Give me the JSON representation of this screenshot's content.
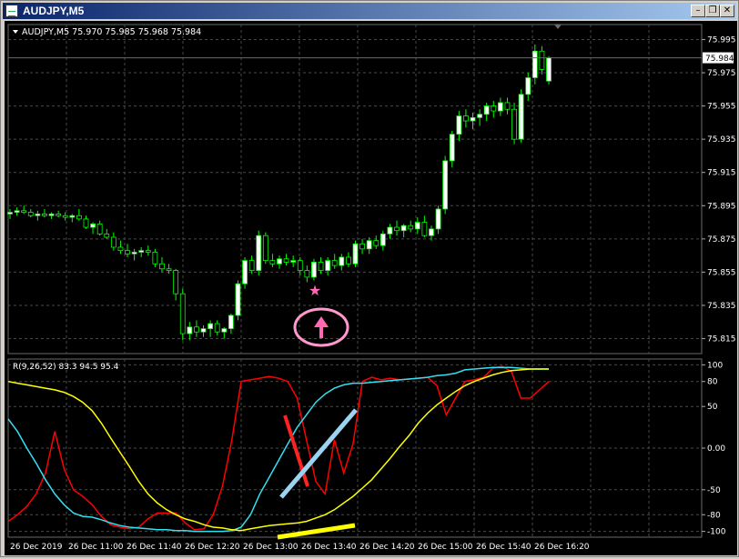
{
  "window": {
    "title": "AUDJPY,M5",
    "minimize_icon": "minimize-icon",
    "restore_icon": "restore-icon",
    "close_icon": "close-icon"
  },
  "header": {
    "symbol_info": "AUDJPY,M5  75.970 75.985 75.968 75.984"
  },
  "colors": {
    "background": "#000000",
    "grid": "#4a4a4a",
    "bull_candle": "#ffffff",
    "candle_outline": "#00ff00",
    "stoch_fast": "#ff0000",
    "stoch_cyan": "#33e0f0",
    "stoch_slow": "#ffff00",
    "price_badge_bg": "#ffffff",
    "star": "#ff69b4",
    "circle": "#ff99cc"
  },
  "chart_data": [
    {
      "type": "candlestick",
      "title": "AUDJPY,M5",
      "ylim": [
        75.806,
        76.004
      ],
      "yticks": [
        "75.995",
        "75.975",
        "75.955",
        "75.935",
        "75.915",
        "75.895",
        "75.875",
        "75.855",
        "75.835",
        "75.815"
      ],
      "current_price": "75.984",
      "candles": [
        [
          75.89,
          75.893,
          75.887,
          75.891
        ],
        [
          75.891,
          75.894,
          75.889,
          75.892
        ],
        [
          75.892,
          75.895,
          75.89,
          75.891
        ],
        [
          75.891,
          75.893,
          75.888,
          75.889
        ],
        [
          75.889,
          75.892,
          75.886,
          75.89
        ],
        [
          75.89,
          75.893,
          75.888,
          75.889
        ],
        [
          75.889,
          75.891,
          75.887,
          75.89
        ],
        [
          75.89,
          75.892,
          75.888,
          75.889
        ],
        [
          75.889,
          75.891,
          75.886,
          75.888
        ],
        [
          75.888,
          75.89,
          75.885,
          75.889
        ],
        [
          75.889,
          75.893,
          75.886,
          75.887
        ],
        [
          75.887,
          75.889,
          75.881,
          75.882
        ],
        [
          75.882,
          75.885,
          75.878,
          75.884
        ],
        [
          75.884,
          75.886,
          75.877,
          75.878
        ],
        [
          75.878,
          75.881,
          75.875,
          75.876
        ],
        [
          75.876,
          75.879,
          75.868,
          75.87
        ],
        [
          75.87,
          75.874,
          75.866,
          75.868
        ],
        [
          75.868,
          75.872,
          75.864,
          75.866
        ],
        [
          75.866,
          75.869,
          75.862,
          75.867
        ],
        [
          75.867,
          75.87,
          75.864,
          75.868
        ],
        [
          75.868,
          75.871,
          75.865,
          75.867
        ],
        [
          75.867,
          75.869,
          75.858,
          75.86
        ],
        [
          75.86,
          75.864,
          75.855,
          75.857
        ],
        [
          75.857,
          75.86,
          75.854,
          75.856
        ],
        [
          75.856,
          75.857,
          75.838,
          75.842
        ],
        [
          75.842,
          75.845,
          75.814,
          75.818
        ],
        [
          75.818,
          75.825,
          75.814,
          75.822
        ],
        [
          75.822,
          75.826,
          75.816,
          75.819
        ],
        [
          75.819,
          75.823,
          75.816,
          75.821
        ],
        [
          75.821,
          75.826,
          75.816,
          75.824
        ],
        [
          75.824,
          75.826,
          75.817,
          75.819
        ],
        [
          75.819,
          75.822,
          75.815,
          75.821
        ],
        [
          75.821,
          75.83,
          75.818,
          75.829
        ],
        [
          75.829,
          75.85,
          75.826,
          75.848
        ],
        [
          75.848,
          75.864,
          75.845,
          75.862
        ],
        [
          75.862,
          75.865,
          75.854,
          75.856
        ],
        [
          75.856,
          75.88,
          75.853,
          75.877
        ],
        [
          75.877,
          75.879,
          75.86,
          75.862
        ],
        [
          75.862,
          75.866,
          75.858,
          75.86
        ],
        [
          75.86,
          75.865,
          75.857,
          75.863
        ],
        [
          75.863,
          75.866,
          75.859,
          75.861
        ],
        [
          75.861,
          75.865,
          75.858,
          75.862
        ],
        [
          75.862,
          75.864,
          75.853,
          75.856
        ],
        [
          75.856,
          75.859,
          75.849,
          75.852
        ],
        [
          75.852,
          75.863,
          75.85,
          75.861
        ],
        [
          75.861,
          75.864,
          75.854,
          75.856
        ],
        [
          75.856,
          75.864,
          75.853,
          75.862
        ],
        [
          75.862,
          75.866,
          75.857,
          75.859
        ],
        [
          75.859,
          75.866,
          75.856,
          75.864
        ],
        [
          75.864,
          75.867,
          75.858,
          75.86
        ],
        [
          75.86,
          75.874,
          75.858,
          75.872
        ],
        [
          75.872,
          75.875,
          75.866,
          75.869
        ],
        [
          75.869,
          75.876,
          75.866,
          75.874
        ],
        [
          75.874,
          75.877,
          75.869,
          75.871
        ],
        [
          75.871,
          75.88,
          75.868,
          75.878
        ],
        [
          75.878,
          75.884,
          75.875,
          75.882
        ],
        [
          75.882,
          75.886,
          75.877,
          75.88
        ],
        [
          75.88,
          75.884,
          75.876,
          75.883
        ],
        [
          75.883,
          75.886,
          75.879,
          75.881
        ],
        [
          75.881,
          75.888,
          75.878,
          75.885
        ],
        [
          75.885,
          75.889,
          75.876,
          75.877
        ],
        [
          75.877,
          75.883,
          75.874,
          75.881
        ],
        [
          75.881,
          75.895,
          75.878,
          75.893
        ],
        [
          75.893,
          75.925,
          75.89,
          75.922
        ],
        [
          75.922,
          75.94,
          75.918,
          75.938
        ],
        [
          75.938,
          75.952,
          75.934,
          75.949
        ],
        [
          75.949,
          75.953,
          75.942,
          75.946
        ],
        [
          75.946,
          75.951,
          75.941,
          75.948
        ],
        [
          75.948,
          75.953,
          75.943,
          75.95
        ],
        [
          75.95,
          75.957,
          75.946,
          75.955
        ],
        [
          75.955,
          75.958,
          75.948,
          75.952
        ],
        [
          75.952,
          75.96,
          75.949,
          75.957
        ],
        [
          75.957,
          75.96,
          75.95,
          75.953
        ],
        [
          75.953,
          75.957,
          75.932,
          75.935
        ],
        [
          75.935,
          75.965,
          75.933,
          75.962
        ],
        [
          75.962,
          75.975,
          75.958,
          75.972
        ],
        [
          75.972,
          75.992,
          75.968,
          75.988
        ],
        [
          75.988,
          75.991,
          75.974,
          75.977
        ],
        [
          75.97,
          75.985,
          75.968,
          75.984
        ]
      ]
    },
    {
      "type": "line",
      "title": "R(9,26,52) 83.3 94.5 95.4",
      "ylim": [
        -107,
        107
      ],
      "yticks": [
        "100",
        "80",
        "50",
        "0.00",
        "-50",
        "-80",
        "-100"
      ],
      "xlabels": [
        "26 Dec 2019",
        "26 Dec 11:00",
        "26 Dec 11:40",
        "26 Dec 12:20",
        "26 Dec 13:00",
        "26 Dec 13:40",
        "26 Dec 14:20",
        "26 Dec 15:00",
        "26 Dec 15:40",
        "26 Dec 16:20"
      ],
      "series": [
        {
          "color": "#ff0000",
          "values": [
            -88,
            -80,
            -70,
            -55,
            -30,
            20,
            -25,
            -50,
            -58,
            -68,
            -82,
            -92,
            -95,
            -97,
            -95,
            -85,
            -78,
            -78,
            -78,
            -90,
            -98,
            -97,
            -80,
            -45,
            10,
            80,
            82,
            84,
            86,
            84,
            80,
            60,
            10,
            -40,
            -55,
            10,
            -30,
            5,
            80,
            85,
            82,
            84,
            82,
            83,
            84,
            85,
            75,
            40,
            60,
            80,
            82,
            85,
            96,
            98,
            92,
            60,
            60,
            70,
            80
          ]
        },
        {
          "color": "#33e0f0",
          "values": [
            35,
            20,
            0,
            -18,
            -38,
            -55,
            -68,
            -78,
            -82,
            -83,
            -86,
            -90,
            -93,
            -95,
            -96,
            -97,
            -98,
            -98,
            -99,
            -99,
            -100,
            -100,
            -100,
            -100,
            -99,
            -95,
            -80,
            -55,
            -35,
            -15,
            5,
            25,
            40,
            55,
            65,
            72,
            76,
            78,
            78,
            79,
            80,
            81,
            82,
            83,
            84,
            85,
            87,
            88,
            90,
            94,
            95,
            96,
            97,
            97,
            97,
            96,
            95,
            95,
            95
          ]
        },
        {
          "color": "#ffff00",
          "values": [
            80,
            78,
            76,
            74,
            72,
            70,
            67,
            62,
            55,
            45,
            30,
            12,
            -5,
            -22,
            -40,
            -55,
            -66,
            -74,
            -80,
            -85,
            -88,
            -92,
            -95,
            -96,
            -98,
            -99,
            -97,
            -95,
            -93,
            -92,
            -91,
            -90,
            -88,
            -84,
            -80,
            -74,
            -66,
            -58,
            -48,
            -38,
            -25,
            -12,
            2,
            15,
            30,
            42,
            52,
            60,
            68,
            75,
            80,
            84,
            88,
            91,
            93,
            94,
            95,
            95,
            95
          ]
        }
      ]
    }
  ]
}
